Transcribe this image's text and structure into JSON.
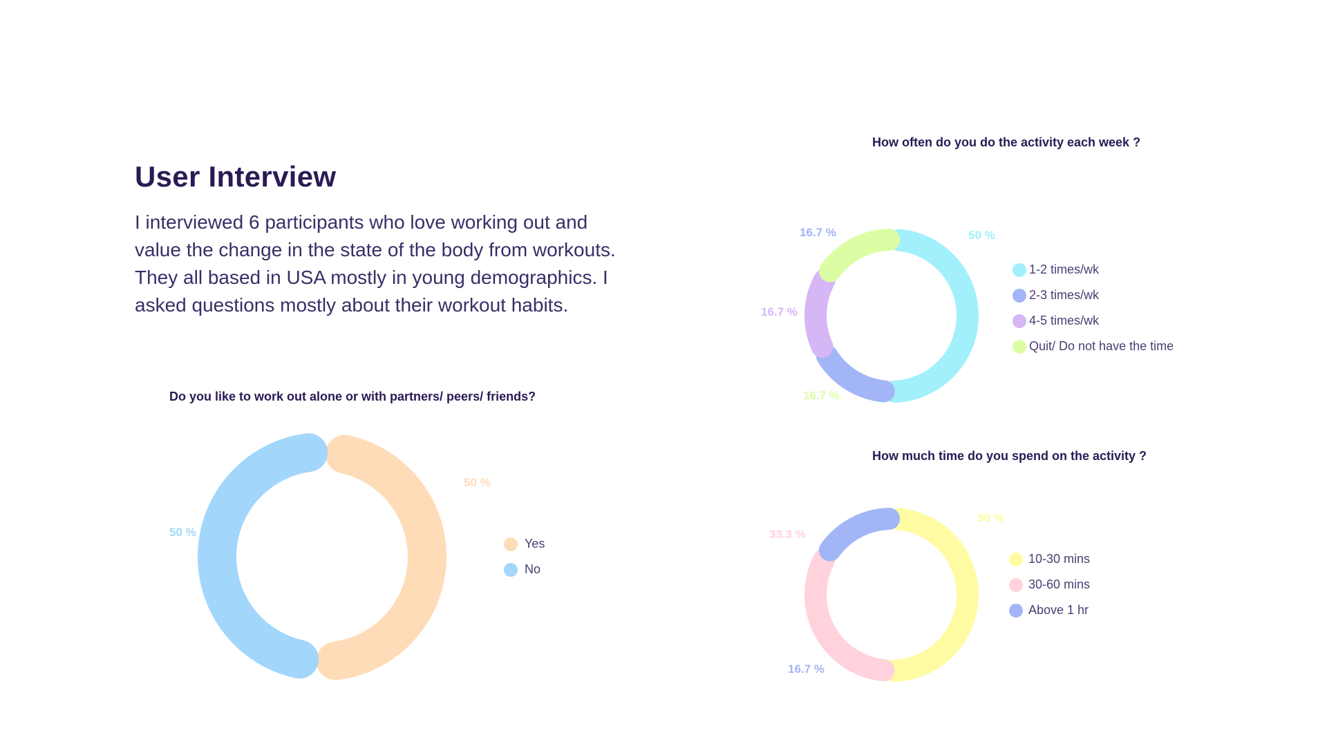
{
  "page": {
    "title": "User Interview",
    "description": "I interviewed 6 participants who love working out and value the change in the state of the body from workouts. They all based in USA mostly in young demographics. I asked questions mostly about their workout habits."
  },
  "chart_data": [
    {
      "type": "pie",
      "title": "Do you like to work out alone or with partners/ peers/ friends?",
      "legend_position": "right",
      "series": [
        {
          "name": "Yes",
          "value": 50,
          "label": "50 %",
          "color": "#ffdcb8"
        },
        {
          "name": "No",
          "value": 50,
          "label": "50 %",
          "color": "#a3d6fb"
        }
      ]
    },
    {
      "type": "pie",
      "title": "How often do you do the activity each week ?",
      "legend_position": "right",
      "series": [
        {
          "name": "1-2 times/wk",
          "value": 50,
          "label": "50 %",
          "color": "#a1f0fb"
        },
        {
          "name": "2-3 times/wk",
          "value": 16.7,
          "label": "16.7 %",
          "color": "#a2b5f6"
        },
        {
          "name": "4-5 times/wk",
          "value": 16.7,
          "label": "16.7 %",
          "color": "#d6b7f6"
        },
        {
          "name": "Quit/ Do not have the time",
          "value": 16.7,
          "label": "16.7 %",
          "color": "#ddfda4"
        }
      ]
    },
    {
      "type": "pie",
      "title": "How much time do you spend on the activity ?",
      "legend_position": "right",
      "series": [
        {
          "name": "10-30 mins",
          "value": 50,
          "label": "50 %",
          "color": "#fffba3"
        },
        {
          "name": "30-60 mins",
          "value": 33.3,
          "label": "33.3 %",
          "color": "#ffd2dc"
        },
        {
          "name": "Above 1 hr",
          "value": 16.7,
          "label": "16.7 %",
          "color": "#a2b5f6"
        }
      ]
    }
  ]
}
